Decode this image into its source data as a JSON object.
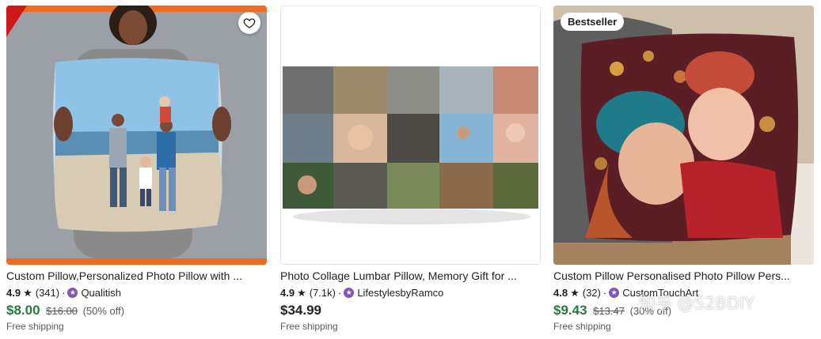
{
  "listings": [
    {
      "title": "Custom Pillow,Personalized Photo Pillow with ...",
      "rating": "4.9",
      "reviews": "(341)",
      "shop": "Qualitish",
      "price": "$8.00",
      "original_price": "$16.00",
      "discount": "(50% off)",
      "shipping": "Free shipping",
      "price_color": "#257a3e",
      "favorite_icon": "heart-icon"
    },
    {
      "title": "Photo Collage Lumbar Pillow, Memory Gift for ...",
      "rating": "4.9",
      "reviews": "(7.1k)",
      "shop": "LifestylesbyRamco",
      "price": "$34.99",
      "shipping": "Free shipping"
    },
    {
      "badge": "Bestseller",
      "title": "Custom Pillow Personalised Photo Pillow Pers...",
      "rating": "4.8",
      "reviews": "(32)",
      "shop": "CustomTouchArt",
      "price": "$9.43",
      "original_price": "$13.47",
      "discount": "(30% off)",
      "shipping": "Free shipping",
      "price_color": "#257a3e"
    }
  ],
  "watermark": "知乎 @S2BDIY",
  "star_icon": "star-icon",
  "shop_icon": "star-seller-icon"
}
